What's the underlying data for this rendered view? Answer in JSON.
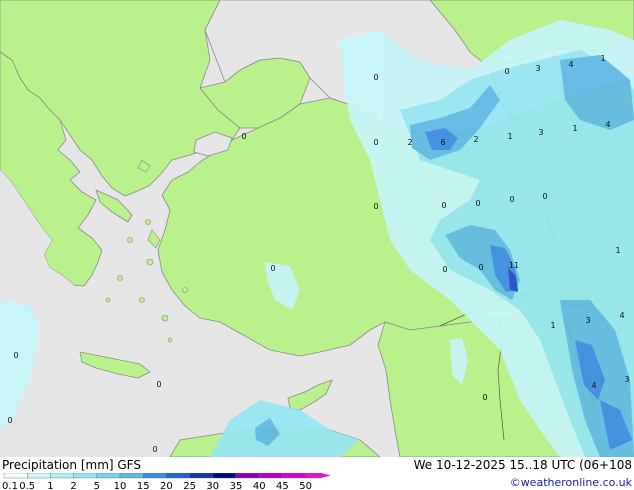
{
  "map": {
    "colors": {
      "sea": "#e6e6e6",
      "land": "#b9f28c",
      "coast": "#8a8a8a",
      "border": "#555555",
      "precip_light": "#c6f6fa",
      "precip_med": "#96e6f2",
      "precip_heavy": "#5fb9e6",
      "precip_vheavy": "#3c8ce6",
      "precip_max": "#2846d2"
    },
    "labels": [
      {
        "id": "l1",
        "text": "0"
      },
      {
        "id": "l2",
        "text": "0"
      },
      {
        "id": "l3",
        "text": "3"
      },
      {
        "id": "l4",
        "text": "4"
      },
      {
        "id": "l5",
        "text": "1"
      },
      {
        "id": "l6",
        "text": "0"
      },
      {
        "id": "l7",
        "text": "2"
      },
      {
        "id": "l8",
        "text": "6"
      },
      {
        "id": "l9",
        "text": "2"
      },
      {
        "id": "l10",
        "text": "1"
      },
      {
        "id": "l11",
        "text": "3"
      },
      {
        "id": "l12",
        "text": "1"
      },
      {
        "id": "l13",
        "text": "4"
      },
      {
        "id": "l14",
        "text": "0"
      },
      {
        "id": "l15",
        "text": "0"
      },
      {
        "id": "l16",
        "text": "0"
      },
      {
        "id": "l17",
        "text": "0"
      },
      {
        "id": "l18",
        "text": "0"
      },
      {
        "id": "l19",
        "text": "0"
      },
      {
        "id": "l20",
        "text": "0"
      },
      {
        "id": "l21",
        "text": "11"
      },
      {
        "id": "l22",
        "text": "0"
      },
      {
        "id": "l23",
        "text": "0"
      },
      {
        "id": "l24",
        "text": "1"
      },
      {
        "id": "l25",
        "text": "1"
      },
      {
        "id": "l26",
        "text": "3"
      },
      {
        "id": "l27",
        "text": "4"
      },
      {
        "id": "l28",
        "text": "4"
      },
      {
        "id": "l29",
        "text": "3"
      },
      {
        "id": "l30",
        "text": "0"
      },
      {
        "id": "l31",
        "text": "0"
      },
      {
        "id": "l32",
        "text": "0"
      },
      {
        "id": "l33",
        "text": "0"
      },
      {
        "id": "l34",
        "text": "0"
      }
    ]
  },
  "footer": {
    "title": "Precipitation [mm] GFS",
    "datetime": "We 10-12-2025 15..18 UTC (06+108",
    "credit": "©weatheronline.co.uk"
  },
  "legend": {
    "ticks": [
      "0.1",
      "0.5",
      "1",
      "2",
      "5",
      "10",
      "15",
      "20",
      "25",
      "30",
      "35",
      "40",
      "45",
      "50"
    ],
    "colors": [
      "#f5fdfe",
      "#d2f5fa",
      "#b4eef6",
      "#96e6f2",
      "#78d2ee",
      "#5fb9e6",
      "#3c8ce6",
      "#1e64d2",
      "#1432a0",
      "#000a78",
      "#8c00b4",
      "#b400c8",
      "#d200d2",
      "#e614c8"
    ]
  }
}
